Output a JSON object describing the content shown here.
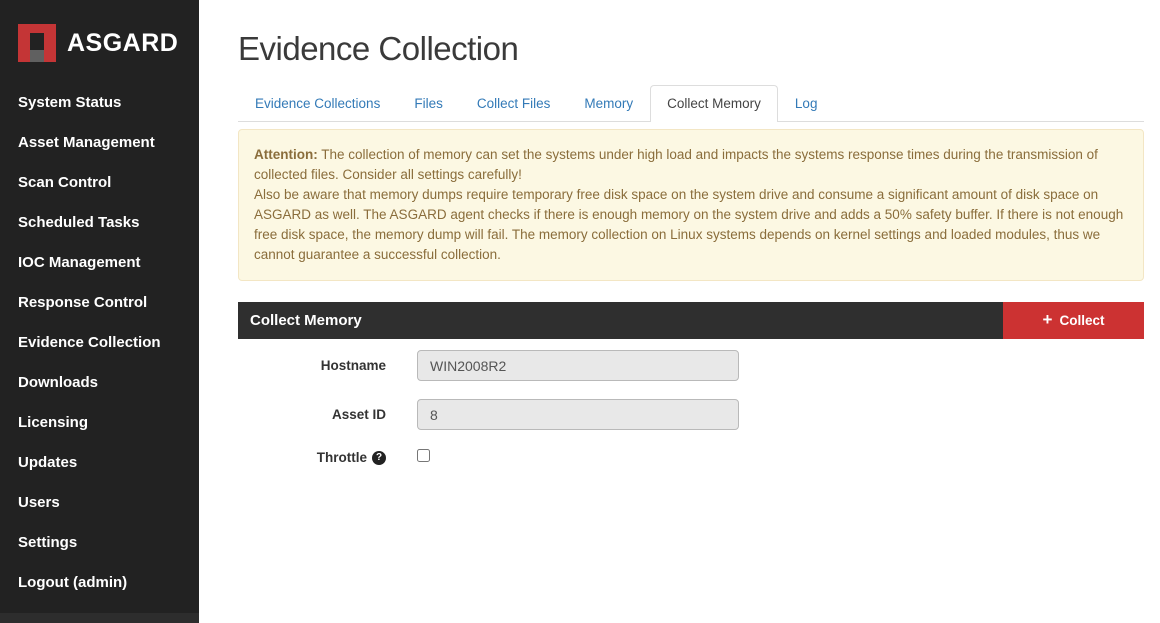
{
  "sidebar": {
    "brand": "ASGARD",
    "items": [
      {
        "label": "System Status"
      },
      {
        "label": "Asset Management"
      },
      {
        "label": "Scan Control"
      },
      {
        "label": "Scheduled Tasks"
      },
      {
        "label": "IOC Management"
      },
      {
        "label": "Response Control"
      },
      {
        "label": "Evidence Collection"
      },
      {
        "label": "Downloads"
      },
      {
        "label": "Licensing"
      },
      {
        "label": "Updates"
      },
      {
        "label": "Users"
      },
      {
        "label": "Settings"
      },
      {
        "label": "Logout (admin)"
      }
    ]
  },
  "header": {
    "title": "Evidence Collection"
  },
  "tabs": [
    {
      "label": "Evidence Collections",
      "active": false
    },
    {
      "label": "Files",
      "active": false
    },
    {
      "label": "Collect Files",
      "active": false
    },
    {
      "label": "Memory",
      "active": false
    },
    {
      "label": "Collect Memory",
      "active": true
    },
    {
      "label": "Log",
      "active": false
    }
  ],
  "alert": {
    "prefix": "Attention:",
    "text1": " The collection of memory can set the systems under high load and impacts the systems response times during the transmission of collected files. Consider all settings carefully!",
    "text2": "Also be aware that memory dumps require temporary free disk space on the system drive and consume a significant amount of disk space on ASGARD as well. The ASGARD agent checks if there is enough memory on the system drive and adds a 50% safety buffer. If there is not enough free disk space, the memory dump will fail. The memory collection on Linux systems depends on kernel settings and loaded modules, thus we cannot guarantee a successful collection."
  },
  "panel": {
    "title": "Collect Memory",
    "plus_icon": "+",
    "collect_button": "Collect"
  },
  "form": {
    "hostname_label": "Hostname",
    "hostname_value": "WIN2008R2",
    "asset_id_label": "Asset ID",
    "asset_id_value": "8",
    "throttle_label": "Throttle",
    "help_icon": "?",
    "throttle_checked": false
  },
  "colors": {
    "sidebar_bg": "#222222",
    "brand_red": "#c43536",
    "accent_red": "#cc3232",
    "link_blue": "#337ab7",
    "panel_header_bg": "#2f2f2f",
    "alert_bg": "#fcf8e3",
    "alert_text": "#8a6d3b",
    "input_bg": "#e8e8e8"
  }
}
